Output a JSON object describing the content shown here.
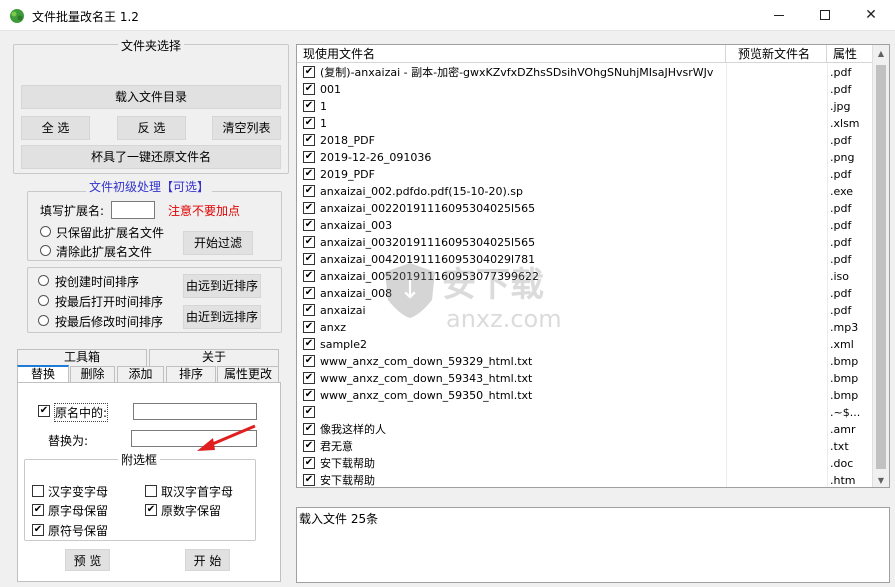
{
  "window": {
    "title": "文件批量改名王  1.2"
  },
  "left": {
    "folder_group": {
      "legend": "文件夹选择",
      "load_button": "载入文件目录",
      "select_all": "全 选",
      "invert": "反 选",
      "clear_list": "清空列表",
      "restore": "杯具了一键还原文件名"
    },
    "filter_group": {
      "legend": "文件初级处理【可选】",
      "ext_label": "填写扩展名:",
      "ext_value": "",
      "ext_hint": "注意不要加点",
      "keep_only": "只保留此扩展名文件",
      "remove_ext": "清除此扩展名文件",
      "start_filter": "开始过滤"
    },
    "sort_group": {
      "by_created": "按创建时间排序",
      "by_opened": "按最后打开时间排序",
      "by_modified": "按最后修改时间排序",
      "far_to_near": "由远到近排序",
      "near_to_far": "由近到远排序"
    },
    "tabs_top": [
      "工具箱",
      "关于"
    ],
    "tabs": [
      "替换",
      "删除",
      "添加",
      "排序",
      "属性更改"
    ],
    "replace": {
      "original_label": "原名中的:",
      "original_checked": true,
      "original_value": "",
      "replace_label": "替换为:",
      "replace_value": "",
      "options_legend": "附选框",
      "opt_hanzi_to_letter": "汉字变字母",
      "opt_hanzi_first": "取汉字首字母",
      "opt_keep_letters": "原字母保留",
      "opt_keep_digits": "原数字保留",
      "opt_keep_symbols": "原符号保留",
      "preview": "预 览",
      "start": "开 始"
    }
  },
  "list": {
    "columns": [
      "现使用文件名",
      "预览新文件名",
      "属性"
    ],
    "rows": [
      {
        "name": "(复制)-anxaizai - 副本-加密-gwxKZvfxDZhsSDsihVOhgSNuhjMIsaJHvsrWJv",
        "ext": ".pdf"
      },
      {
        "name": "001",
        "ext": ".pdf"
      },
      {
        "name": "1",
        "ext": ".jpg"
      },
      {
        "name": "1",
        "ext": ".xlsm"
      },
      {
        "name": "2018_PDF",
        "ext": ".pdf"
      },
      {
        "name": "2019-12-26_091036",
        "ext": ".png"
      },
      {
        "name": "2019_PDF",
        "ext": ".pdf"
      },
      {
        "name": "anxaizai_002.pdfdo.pdf(15-10-20).sp",
        "ext": ".exe"
      },
      {
        "name": "anxaizai_00220191116095304025l565",
        "ext": ".pdf"
      },
      {
        "name": "anxaizai_003",
        "ext": ".pdf"
      },
      {
        "name": "anxaizai_00320191116095304025l565",
        "ext": ".pdf"
      },
      {
        "name": "anxaizai_00420191116095304029l781",
        "ext": ".pdf"
      },
      {
        "name": "anxaizai_005201911160953077399622",
        "ext": ".iso"
      },
      {
        "name": "anxaizai_008",
        "ext": ".pdf"
      },
      {
        "name": "anxaizai",
        "ext": ".pdf"
      },
      {
        "name": "anxz",
        "ext": ".mp3"
      },
      {
        "name": "sample2",
        "ext": ".xml"
      },
      {
        "name": "www_anxz_com_down_59329_html.txt",
        "ext": ".bmp"
      },
      {
        "name": "www_anxz_com_down_59343_html.txt",
        "ext": ".bmp"
      },
      {
        "name": "www_anxz_com_down_59350_html.txt",
        "ext": ".bmp"
      },
      {
        "name": "",
        "ext": ".~$..."
      },
      {
        "name": "像我这样的人",
        "ext": ".amr"
      },
      {
        "name": "君无意",
        "ext": ".txt"
      },
      {
        "name": "安下载帮助",
        "ext": ".doc"
      },
      {
        "name": "安下载帮助",
        "ext": ".htm"
      }
    ]
  },
  "log": {
    "text": "载入文件  25条"
  },
  "watermark": {
    "cn": "安下载",
    "en": "anxz.com"
  },
  "colors": {
    "accent": "#1e7bd8",
    "hint": "#e00000",
    "legend_blue": "#3333cc",
    "arrow": "#e02020"
  }
}
